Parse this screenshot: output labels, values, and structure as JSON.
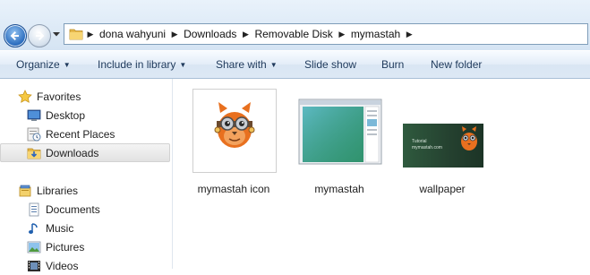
{
  "address_bar": {
    "breadcrumbs": [
      "dona wahyuni",
      "Downloads",
      "Removable Disk",
      "mymastah"
    ]
  },
  "toolbar": {
    "organize": "Organize",
    "include_in_library": "Include in library",
    "share_with": "Share with",
    "slide_show": "Slide show",
    "burn": "Burn",
    "new_folder": "New folder"
  },
  "nav_pane": {
    "favorites_header": "Favorites",
    "favorites": [
      {
        "label": "Desktop",
        "icon": "desktop-icon"
      },
      {
        "label": "Recent Places",
        "icon": "recent-places-icon"
      },
      {
        "label": "Downloads",
        "icon": "downloads-folder-icon",
        "selected": true
      }
    ],
    "libraries_header": "Libraries",
    "libraries": [
      {
        "label": "Documents",
        "icon": "documents-icon"
      },
      {
        "label": "Music",
        "icon": "music-icon"
      },
      {
        "label": "Pictures",
        "icon": "pictures-icon"
      },
      {
        "label": "Videos",
        "icon": "videos-icon"
      }
    ]
  },
  "files": [
    {
      "name": "mymastah icon",
      "thumbnail": "owl-mascot-icon"
    },
    {
      "name": "mymastah",
      "thumbnail": "window-screenshot-thumbnail"
    },
    {
      "name": "wallpaper",
      "thumbnail": "green-wallpaper-thumbnail"
    }
  ],
  "wallpaper_text": [
    "Tutorial",
    "mymastah.com"
  ],
  "colors": {
    "toolbar_text": "#1e395b",
    "selection": "#e2e2e2",
    "mascot_orange": "#e8701f"
  }
}
